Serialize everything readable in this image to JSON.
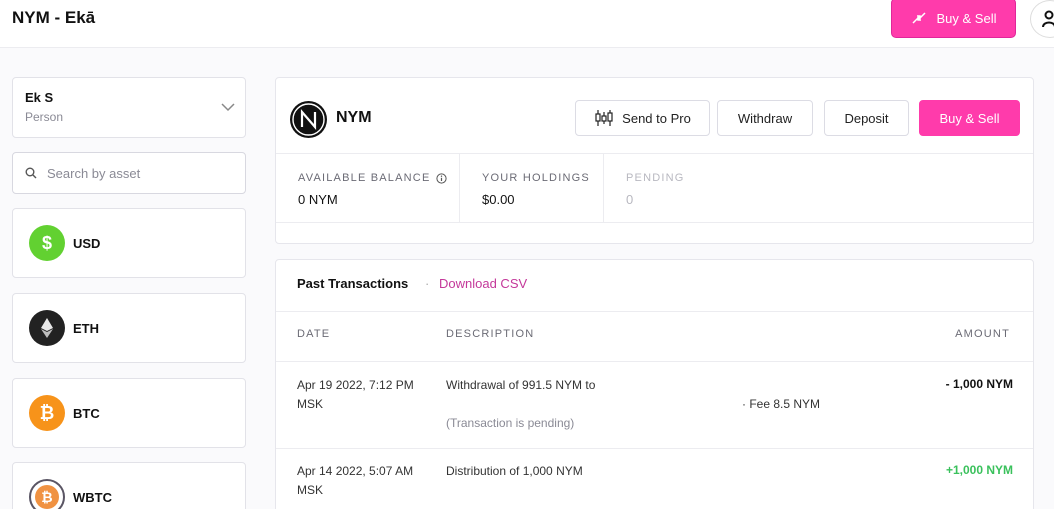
{
  "header": {
    "title": "NYM - Ekā",
    "buy_sell_label": "Buy & Sell"
  },
  "account": {
    "name": "Ek S",
    "type": "Person"
  },
  "search": {
    "placeholder": "Search by asset"
  },
  "assets": [
    {
      "label": "USD",
      "icon": "dollar-icon",
      "color": "#62d131"
    },
    {
      "label": "ETH",
      "icon": "ethereum-icon",
      "color": "#222222"
    },
    {
      "label": "BTC",
      "icon": "bitcoin-icon",
      "color": "#f7931a"
    },
    {
      "label": "WBTC",
      "icon": "wrapped-bitcoin-icon",
      "color": "#5a5564"
    }
  ],
  "asset_panel": {
    "name": "NYM",
    "actions": {
      "send_to_pro": "Send to Pro",
      "withdraw": "Withdraw",
      "deposit": "Deposit",
      "buy_sell": "Buy & Sell"
    },
    "stats": [
      {
        "label": "AVAILABLE BALANCE",
        "value": "0 NYM"
      },
      {
        "label": "YOUR HOLDINGS",
        "value": "$0.00"
      },
      {
        "label": "PENDING",
        "value": "0"
      }
    ]
  },
  "transactions": {
    "title": "Past Transactions",
    "separator": "·",
    "download_label": "Download CSV",
    "columns": {
      "date": "DATE",
      "description": "DESCRIPTION",
      "amount": "AMOUNT"
    },
    "rows": [
      {
        "date_line1": "Apr 19 2022, 7:12 PM",
        "date_line2": "MSK",
        "description": "Withdrawal of 991.5 NYM to",
        "fee": "· Fee 8.5 NYM",
        "status": "(Transaction is pending)",
        "amount": "- 1,000 NYM"
      },
      {
        "date_line1": "Apr 14 2022, 5:07 AM",
        "date_line2": "MSK",
        "description": "Distribution of 1,000 NYM",
        "amount": "+1,000 NYM"
      }
    ]
  },
  "colors": {
    "accent": "#ff3bab",
    "link": "#c4389a",
    "positive": "#3ac15c"
  }
}
